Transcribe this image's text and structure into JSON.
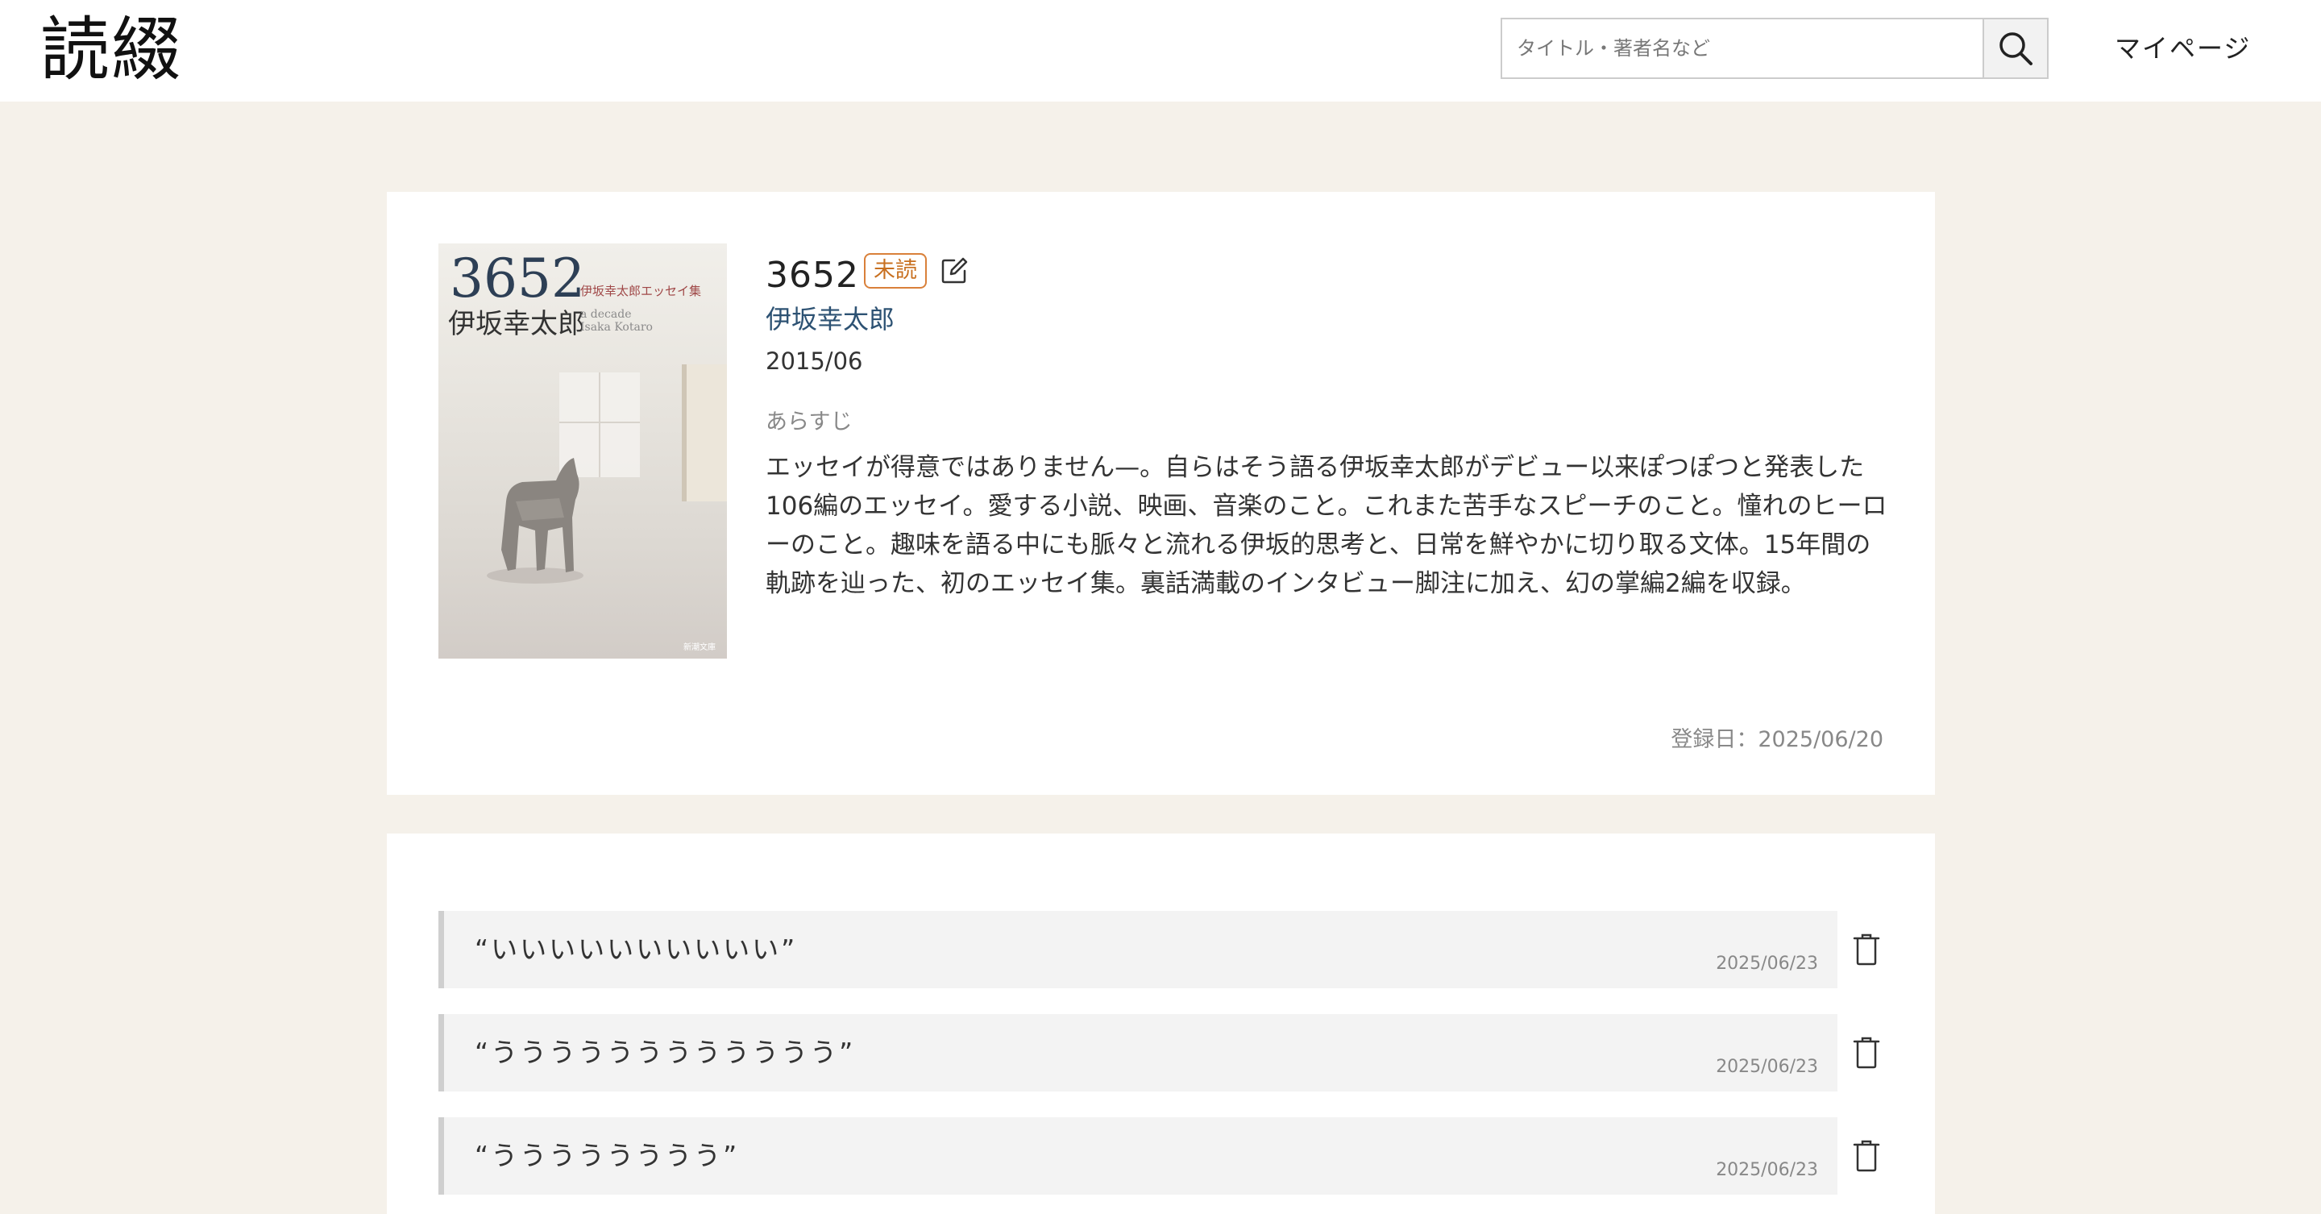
{
  "header": {
    "logo": "読綴",
    "search_placeholder": "タイトル・著者名など",
    "search_value": "",
    "mypage_label": "マイページ"
  },
  "book": {
    "title": "3652",
    "status": "未読",
    "author": "伊坂幸太郎",
    "published": "2015/06",
    "synopsis_label": "あらすじ",
    "synopsis": "エッセイが得意ではありません—。自らはそう語る伊坂幸太郎がデビュー以来ぽつぽつと発表した106編のエッセイ。愛する小説、映画、音楽のこと。これまた苦手なスピーチのこと。憧れのヒーローのこと。趣味を語る中にも脈々と流れる伊坂的思考と、日常を鮮やかに切り取る文体。15年間の軌跡を辿った、初のエッセイ集。裏話満載のインタビュー脚注に加え、幻の掌編2編を収録。",
    "registered": "登録日：2025/06/20",
    "cover": {
      "title": "3652",
      "subtitle": "伊坂幸太郎エッセイ集",
      "author": "伊坂幸太郎",
      "decade_line1": "a decade",
      "decade_line2": "Isaka Kotaro",
      "publisher": "新潮文庫"
    }
  },
  "notes": [
    {
      "text": "“いいいいいいいいいい”",
      "date": "2025/06/23"
    },
    {
      "text": "“うううううううううううう”",
      "date": "2025/06/23"
    },
    {
      "text": "“うううううううう”",
      "date": "2025/06/23"
    }
  ],
  "colors": {
    "background": "#f5f1ea",
    "status_badge": "#d9803a",
    "author_link": "#2d5273",
    "cover_title": "#2d3f55"
  },
  "icons": {
    "search": "search-icon",
    "edit": "edit-icon",
    "delete": "trash-icon"
  }
}
